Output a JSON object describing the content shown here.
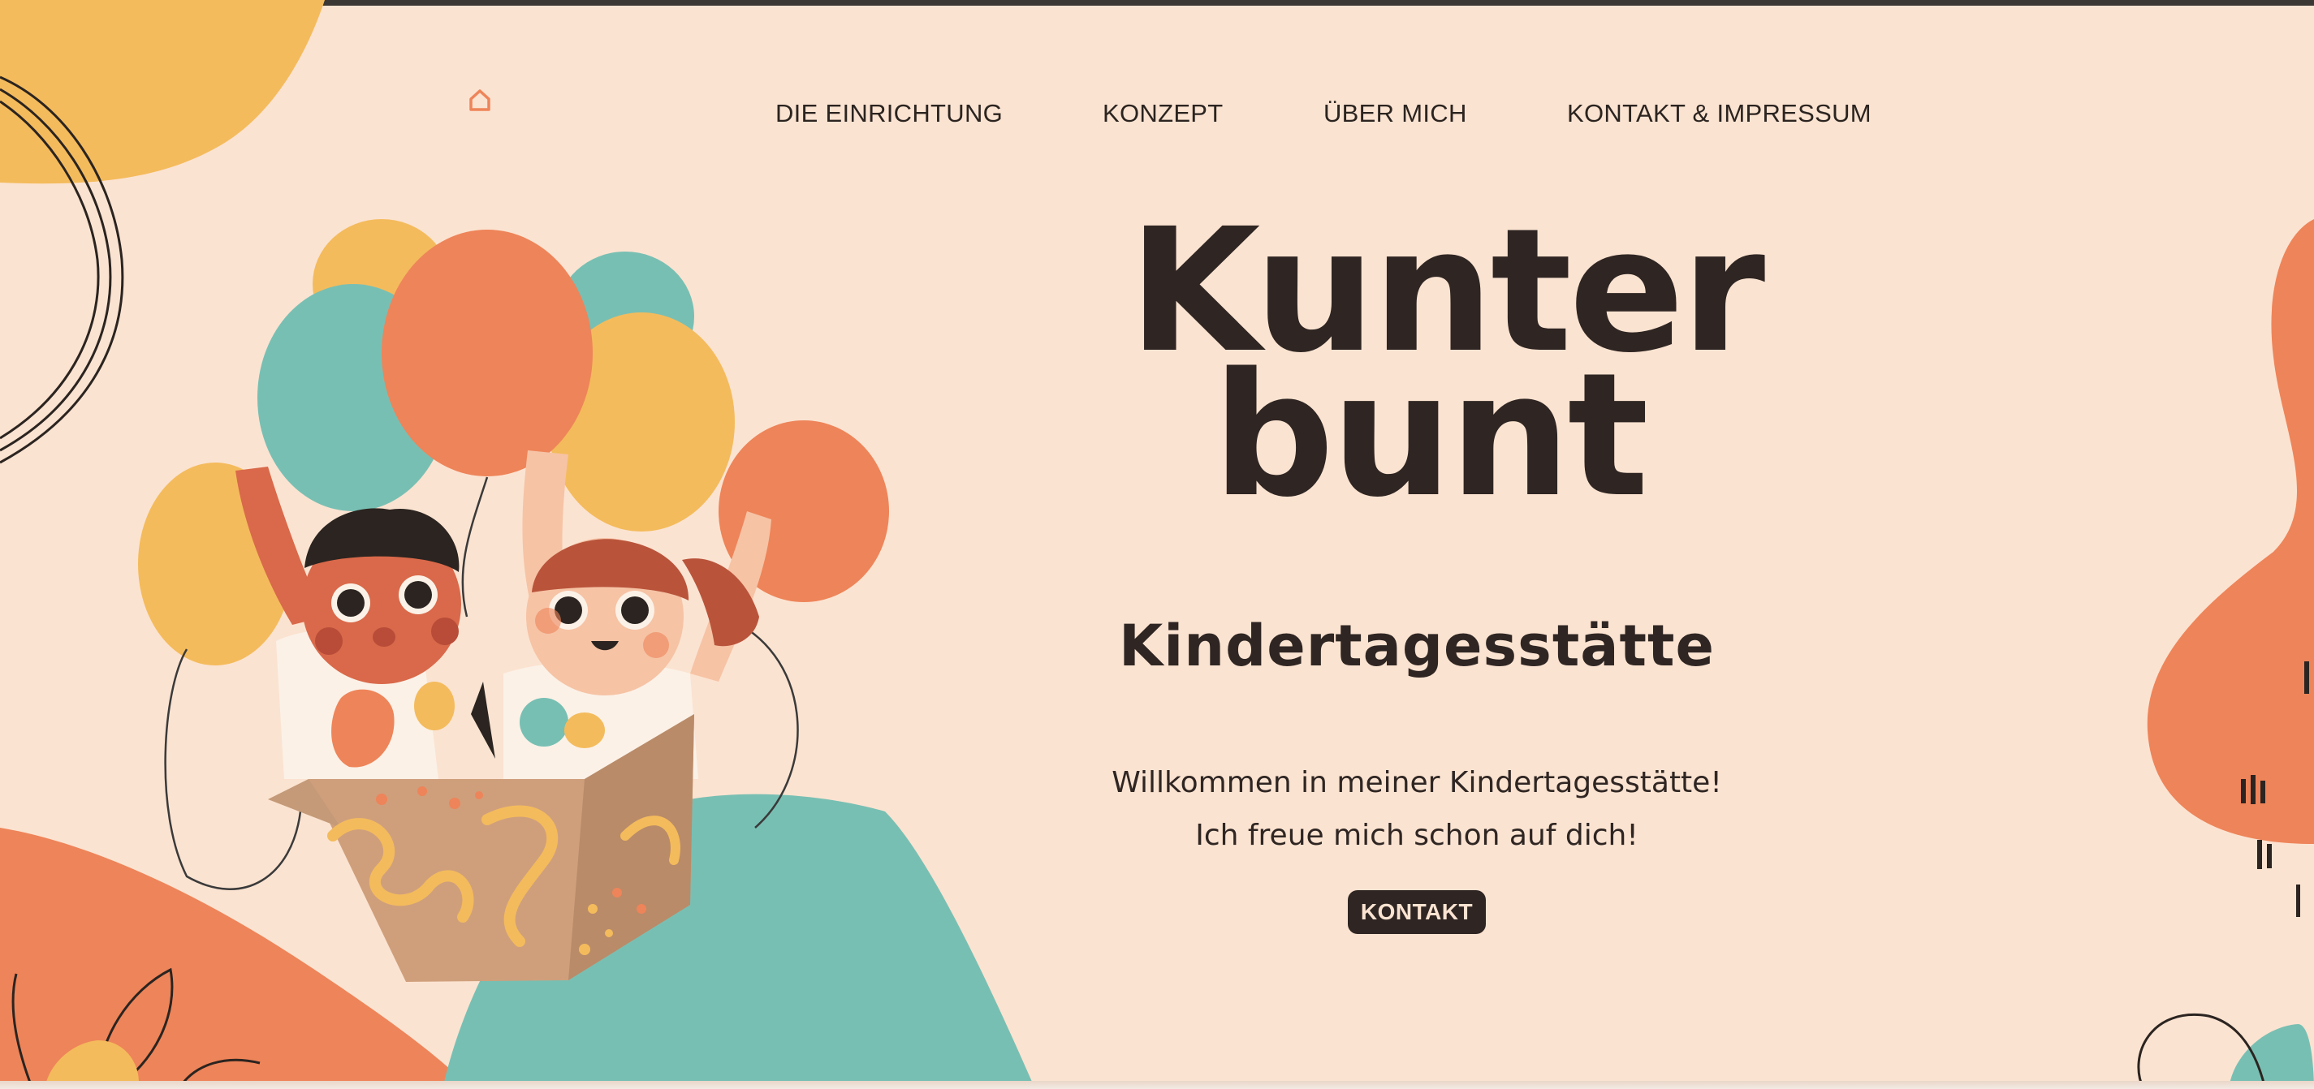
{
  "colors": {
    "background": "#fbe3d1",
    "orange": "#ee8459",
    "yellow": "#f4bb5c",
    "teal": "#78bfb3",
    "dark": "#2f2623"
  },
  "header": {
    "home_icon": "house-icon",
    "nav": [
      {
        "label": "DIE EINRICHTUNG"
      },
      {
        "label": "KONZEPT"
      },
      {
        "label": "ÜBER MICH"
      },
      {
        "label": "KONTAKT & IMPRESSUM"
      }
    ]
  },
  "hero": {
    "title_line1": "Kunter",
    "title_line2": "bunt",
    "subtitle": "Kindertagesstätte",
    "welcome_line1": "Willkommen in meiner Kindertagesstätte!",
    "welcome_line2": "Ich freue mich schon auf dich!",
    "cta_label": "KONTAKT"
  }
}
